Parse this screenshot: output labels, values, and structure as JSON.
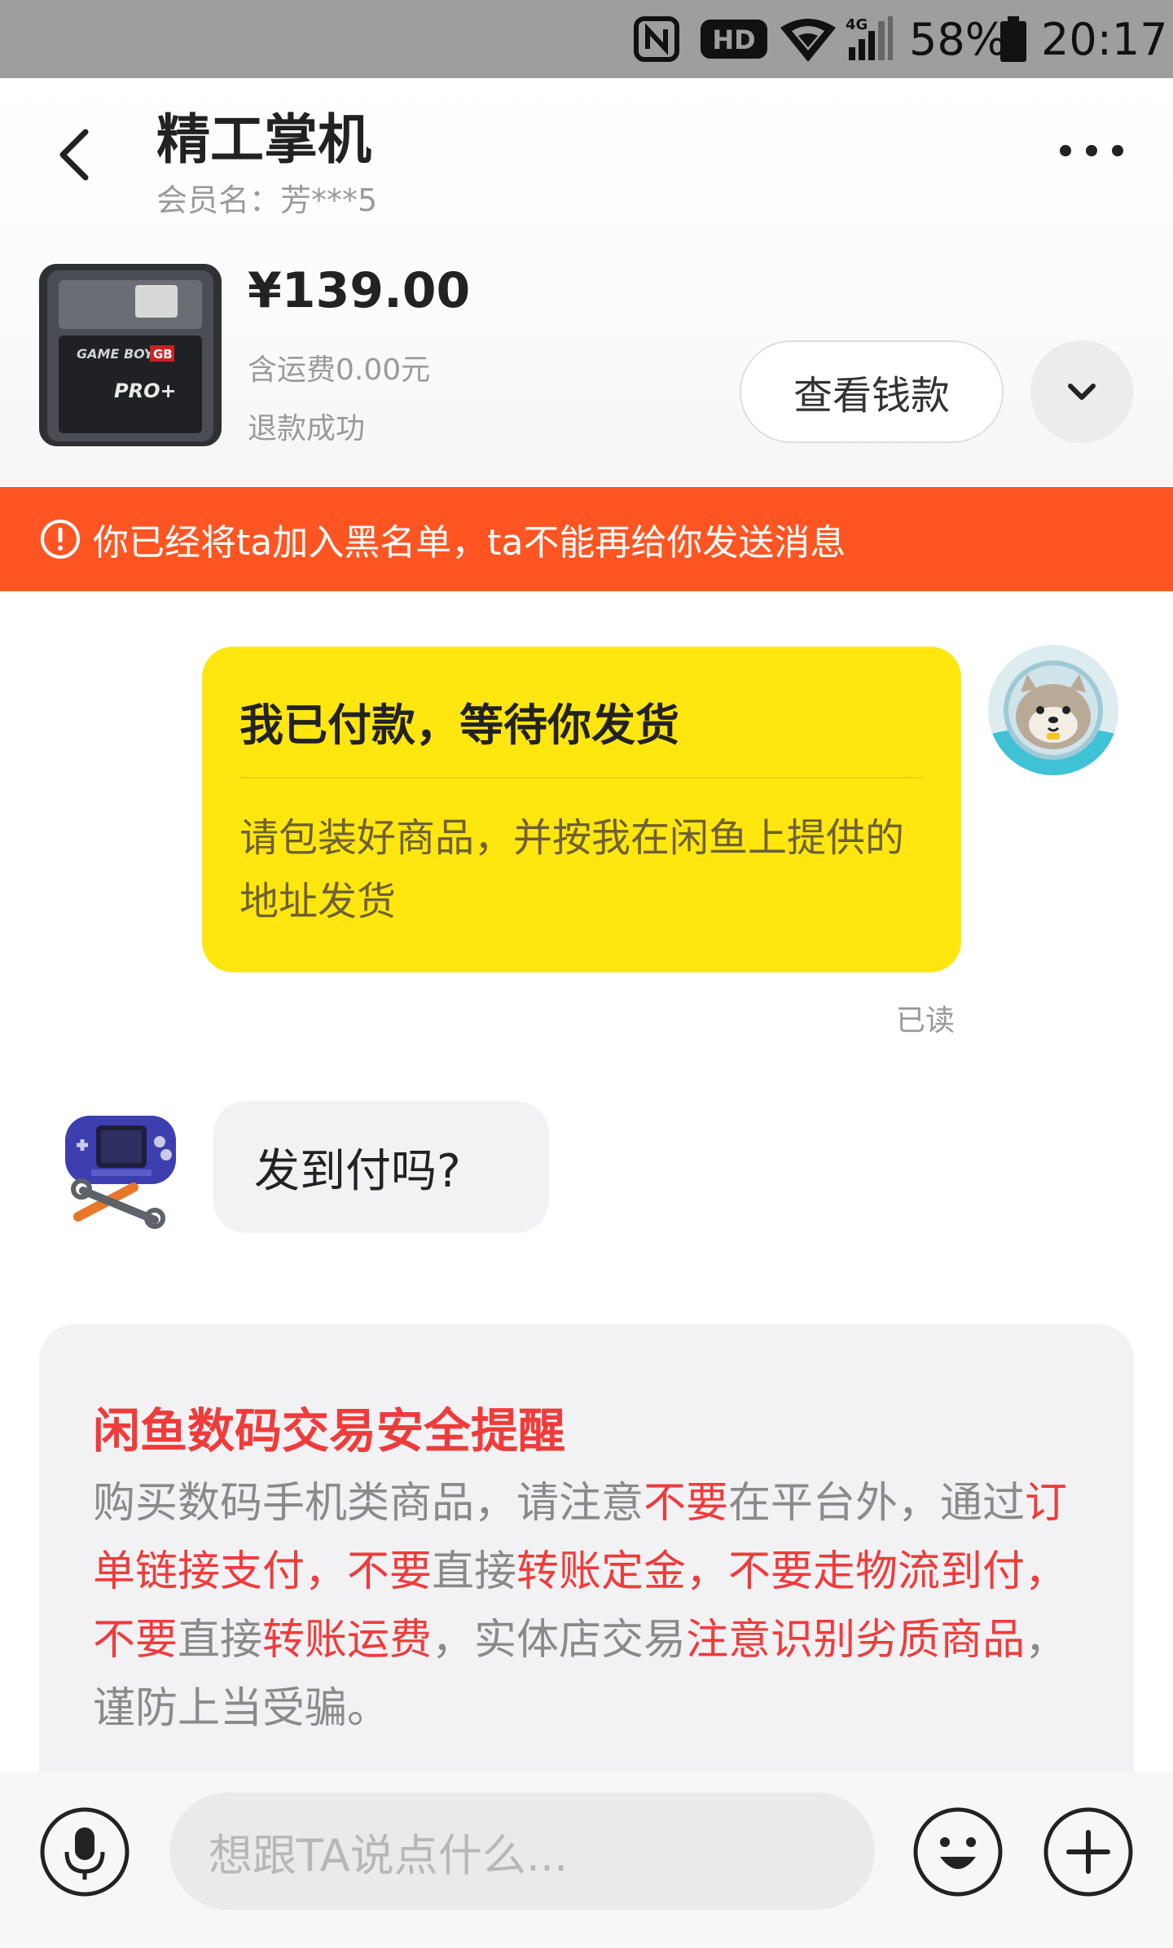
{
  "status_bar": {
    "battery": "58%",
    "time": "20:17",
    "network": "4G",
    "icons": [
      "nfc-icon",
      "hd-icon",
      "wifi-icon",
      "signal-icon",
      "battery-icon"
    ]
  },
  "header": {
    "title": "精工掌机",
    "member": "会员名：芳***5"
  },
  "item": {
    "price": "¥139.00",
    "shipping": "含运费0.00元",
    "status": "退款成功",
    "view_label": "查看钱款",
    "thumb_text_1": "GAME BOY",
    "thumb_text_2": "GB",
    "thumb_text_3": "PRO+"
  },
  "banner": {
    "text": "你已经将ta加入黑名单，ta不能再给你发送消息"
  },
  "chat": {
    "card_title": "我已付款，等待你发货",
    "card_body": "请包装好商品，并按我在闲鱼上提供的地址发货",
    "read": "已读",
    "other_message": "发到付吗?"
  },
  "notice": {
    "title": "闲鱼数码交易安全提醒",
    "segments": [
      {
        "text": "购买数码手机类商品，请注意",
        "red": false
      },
      {
        "text": "不要",
        "red": true
      },
      {
        "text": "在平台外，通过",
        "red": false
      },
      {
        "text": "订单链接支付，不要",
        "red": true
      },
      {
        "text": "直接",
        "red": false
      },
      {
        "text": "转账定金，不要走物流到付，不要",
        "red": true
      },
      {
        "text": "直接",
        "red": false
      },
      {
        "text": "转账运费",
        "red": true
      },
      {
        "text": "，实体店交易",
        "red": false
      },
      {
        "text": "注意识别劣质商品",
        "red": true
      },
      {
        "text": "，谨防上当受骗。",
        "red": false
      }
    ]
  },
  "input": {
    "placeholder": "想跟TA说点什么..."
  },
  "colors": {
    "banner": "#ff5522",
    "card": "#ffe60f",
    "alert_red": "#f03b3b"
  }
}
